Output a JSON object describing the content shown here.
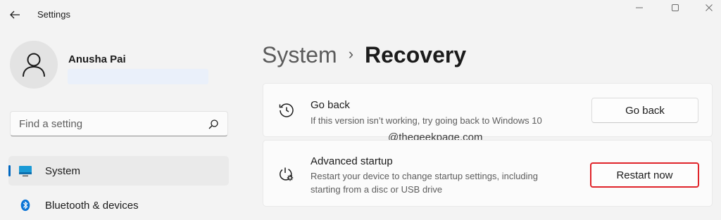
{
  "window": {
    "title": "Settings",
    "controls": {
      "minimize": "minimize",
      "maximize": "maximize",
      "close": "close"
    }
  },
  "user": {
    "name": "Anusha Pai"
  },
  "search": {
    "placeholder": "Find a setting"
  },
  "nav": {
    "items": [
      {
        "label": "System",
        "icon": "monitor-icon",
        "selected": true
      },
      {
        "label": "Bluetooth & devices",
        "icon": "bluetooth-icon",
        "selected": false
      }
    ]
  },
  "breadcrumb": {
    "parent": "System",
    "separator": "›",
    "current": "Recovery"
  },
  "cards": {
    "go_back": {
      "title": "Go back",
      "description": "If this version isn’t working, try going back to Windows 10",
      "button": "Go back",
      "icon": "history-icon"
    },
    "advanced_startup": {
      "title": "Advanced startup",
      "description": "Restart your device to change startup settings, including starting from a disc or USB drive",
      "button": "Restart now",
      "icon": "power-settings-icon"
    }
  },
  "watermark": "@thegeekpage.com",
  "colors": {
    "accent": "#0067c0",
    "highlight": "#e0242a",
    "background": "#f3f3f3"
  }
}
